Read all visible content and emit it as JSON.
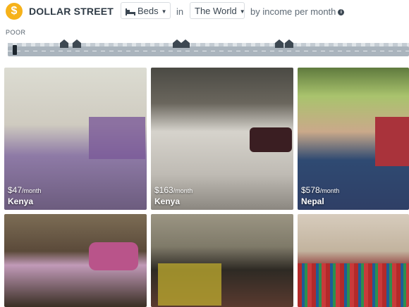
{
  "header": {
    "logo_symbol": "$",
    "brand": "DOLLAR STREET",
    "category": "Beds",
    "in_word": "in",
    "region": "The World",
    "by_text": "by income per month",
    "info_symbol": "i"
  },
  "slider": {
    "left_label": "POOR"
  },
  "cards": [
    {
      "income": "$47",
      "unit": "/month",
      "country": "Kenya"
    },
    {
      "income": "$163",
      "unit": "/month",
      "country": "Kenya"
    },
    {
      "income": "$578",
      "unit": "/month",
      "country": "Nepal"
    },
    {
      "income": "",
      "unit": "",
      "country": ""
    },
    {
      "income": "",
      "unit": "",
      "country": ""
    },
    {
      "income": "",
      "unit": "",
      "country": ""
    }
  ],
  "colors": {
    "accent": "#f6b21a",
    "slider_track": "#aab4bd",
    "house": "#3d4852"
  }
}
